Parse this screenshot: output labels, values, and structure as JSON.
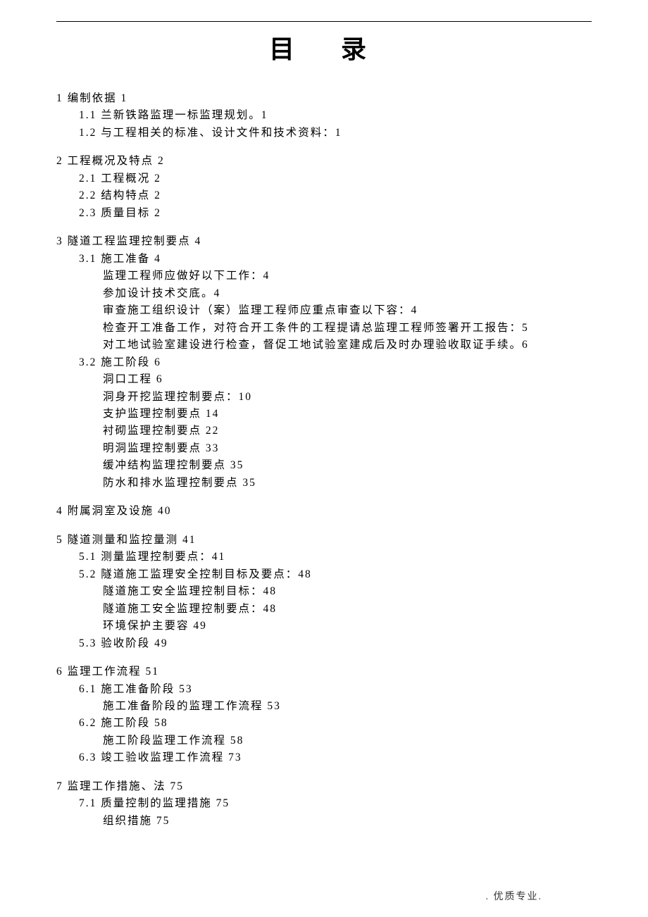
{
  "title": "目 录",
  "footer": ". 优质专业.",
  "toc": {
    "s1": {
      "h": "1 编制依据 1",
      "i1": "1.1 兰新铁路监理一标监理规划。1",
      "i2": "1.2 与工程相关的标准、设计文件和技术资料：1"
    },
    "s2": {
      "h": "2 工程概况及特点 2",
      "i1": "2.1 工程概况 2",
      "i2": "2.2 结构特点 2",
      "i3": "2.3 质量目标 2"
    },
    "s3": {
      "h": "3 隧道工程监理控制要点 4",
      "i1": "3.1 施工准备 4",
      "i1a": "监理工程师应做好以下工作：4",
      "i1b": "参加设计技术交底。4",
      "i1c": "审查施工组织设计（案）监理工程师应重点审查以下容：4",
      "i1d": "检查开工准备工作，对符合开工条件的工程提请总监理工程师签署开工报告：5",
      "i1e": "对工地试验室建设进行检查，督促工地试验室建成后及时办理验收取证手续。6",
      "i2": "3.2 施工阶段 6",
      "i2a": "洞口工程 6",
      "i2b": "洞身开挖监理控制要点：10",
      "i2c": "支护监理控制要点 14",
      "i2d": "衬砌监理控制要点 22",
      "i2e": "明洞监理控制要点 33",
      "i2f": "缓冲结构监理控制要点 35",
      "i2g": "防水和排水监理控制要点 35"
    },
    "s4": {
      "h": "4 附属洞室及设施 40"
    },
    "s5": {
      "h": "5 隧道测量和监控量测 41",
      "i1": "5.1 测量监理控制要点：41",
      "i2": "5.2 隧道施工监理安全控制目标及要点：48",
      "i2a": "隧道施工安全监理控制目标：48",
      "i2b": "隧道施工安全监理控制要点：48",
      "i2c": "环境保护主要容 49",
      "i3": "5.3 验收阶段 49"
    },
    "s6": {
      "h": "6 监理工作流程 51",
      "i1": "6.1 施工准备阶段 53",
      "i1a": "施工准备阶段的监理工作流程 53",
      "i2": "6.2 施工阶段 58",
      "i2a": "施工阶段监理工作流程 58",
      "i3": "6.3 竣工验收监理工作流程 73"
    },
    "s7": {
      "h": "7 监理工作措施、法 75",
      "i1": "7.1 质量控制的监理措施 75",
      "i1a": "组织措施 75"
    }
  }
}
